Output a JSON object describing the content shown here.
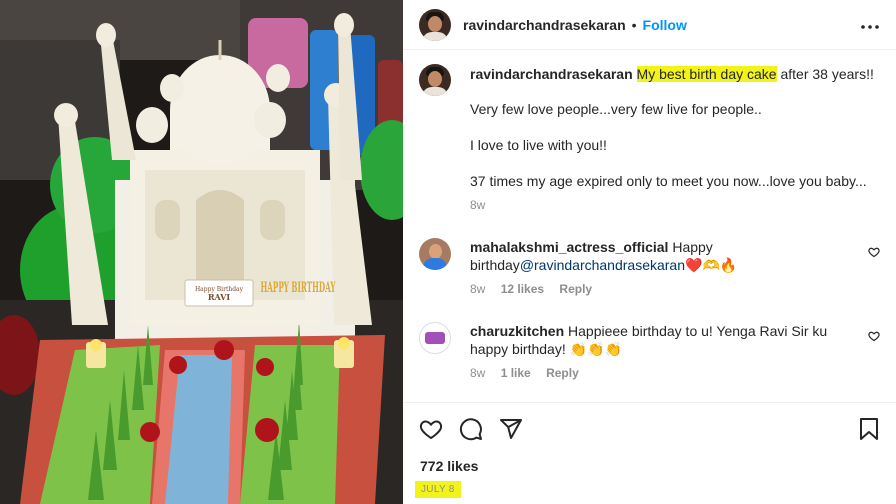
{
  "post": {
    "username": "ravindarchandrasekaran",
    "separator": "•",
    "follow_label": "Follow",
    "more_label": "•••",
    "caption": {
      "username": "ravindarchandrasekaran",
      "highlight": "My best birth day cake",
      "rest": " after 38 years!!",
      "line2": "Very few love people...very few live for people..",
      "line3": "I love to live with you!!",
      "line4": "37 times my age expired only to meet you now...love you baby...",
      "age": "8w"
    },
    "comments": [
      {
        "username": "mahalakshmi_actress_official",
        "text_before": " Happy birthday",
        "mention": "@ravindarchandrasekaran",
        "emoji": "❤️🫶🔥",
        "age": "8w",
        "likes": "12 likes",
        "reply": "Reply"
      },
      {
        "username": "charuzkitchen",
        "text": " Happieee birthday to u! Yenga Ravi Sir ku happy birthday! 👏👏👏",
        "age": "8w",
        "likes": "1 like",
        "reply": "Reply"
      }
    ],
    "likes_count": "772 likes",
    "date": "JULY 8"
  },
  "photo": {
    "cake_plaque_line1": "Happy Birthday",
    "cake_plaque_line2": "RAVI",
    "cake_topper": "HAPPY BIRTHDAY"
  },
  "icons": {
    "like": "heart-icon",
    "comment": "comment-icon",
    "share": "share-icon",
    "save": "bookmark-icon",
    "more": "more-icon"
  }
}
